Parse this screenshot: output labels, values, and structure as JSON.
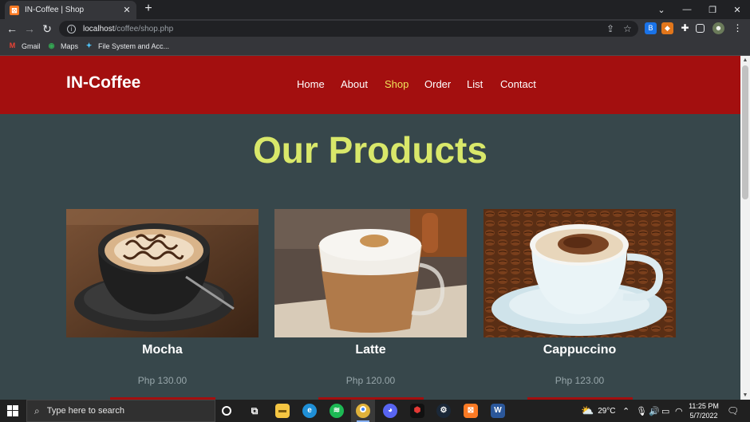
{
  "browser": {
    "tab_title": "IN-Coffee | Shop",
    "url_host": "localhost",
    "url_path": "/coffee/shop.php",
    "bookmarks": [
      "Gmail",
      "Maps",
      "File System and Acc..."
    ]
  },
  "site": {
    "logo": "IN-Coffee",
    "nav": [
      "Home",
      "About",
      "Shop",
      "Order",
      "List",
      "Contact"
    ],
    "active_nav": "Shop",
    "section_title": "Our Products",
    "products": [
      {
        "name": "Mocha",
        "price": "Php 130.00"
      },
      {
        "name": "Latte",
        "price": "Php 120.00"
      },
      {
        "name": "Cappuccino",
        "price": "Php 123.00"
      }
    ]
  },
  "taskbar": {
    "search_placeholder": "Type here to search",
    "weather": "29°C",
    "time": "11:25 PM",
    "date": "5/7/2022"
  },
  "colors": {
    "header": "#a30f0f",
    "page_bg": "#37474b",
    "title": "#d9e86a",
    "active_link": "#f0e35a"
  }
}
